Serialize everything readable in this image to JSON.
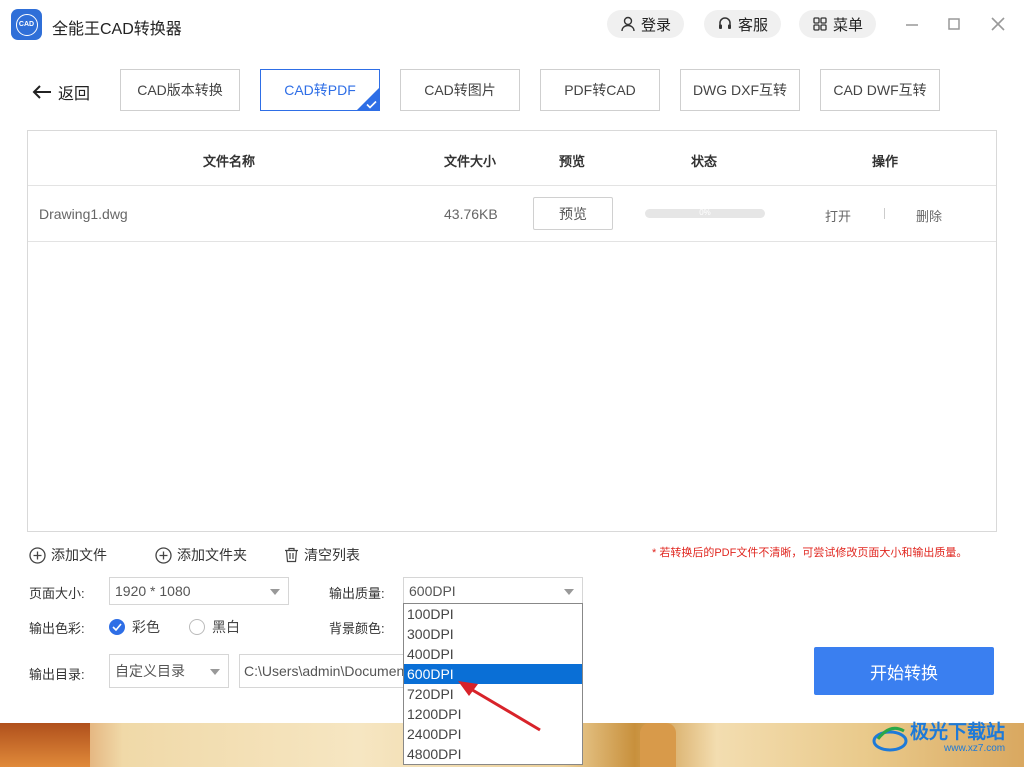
{
  "window": {
    "logo_text": "CAD",
    "title": "全能王CAD转换器",
    "login_label": "登录",
    "service_label": "客服",
    "menu_label": "菜单"
  },
  "nav": {
    "back_label": "返回",
    "tabs": [
      {
        "label": "CAD版本转换"
      },
      {
        "label": "CAD转PDF"
      },
      {
        "label": "CAD转图片"
      },
      {
        "label": "PDF转CAD"
      },
      {
        "label": "DWG DXF互转"
      },
      {
        "label": "CAD DWF互转"
      }
    ],
    "active_tab": "CAD转PDF"
  },
  "table": {
    "headers": {
      "name": "文件名称",
      "size": "文件大小",
      "preview": "预览",
      "status": "状态",
      "actions": "操作"
    },
    "rows": [
      {
        "name": "Drawing1.dwg",
        "size": "43.76KB",
        "preview_label": "预览",
        "progress_text": "0%",
        "progress": 0,
        "open_label": "打开",
        "delete_label": "删除"
      }
    ]
  },
  "actions": {
    "add_file": "添加文件",
    "add_folder": "添加文件夹",
    "clear_list": "清空列表",
    "hint": "* 若转换后的PDF文件不清晰，可尝试修改页面大小和输出质量。"
  },
  "settings": {
    "page_size_label": "页面大小:",
    "page_size_value": "1920 * 1080",
    "quality_label": "输出质量:",
    "quality_value": "600DPI",
    "color_label": "输出色彩:",
    "color_option": "彩色",
    "bw_option": "黑白",
    "selected_color": "彩色",
    "bg_color_label": "背景颜色:",
    "output_dir_label": "输出目录:",
    "output_dir_mode": "自定义目录",
    "output_path": "C:\\Users\\admin\\Documents"
  },
  "quality_dropdown": {
    "options": [
      "100DPI",
      "300DPI",
      "400DPI",
      "600DPI",
      "720DPI",
      "1200DPI",
      "2400DPI",
      "4800DPI"
    ],
    "highlighted": "600DPI"
  },
  "start_button": "开始转换",
  "watermark": {
    "text": "极光下载站",
    "sub": "www.xz7.com"
  },
  "colors": {
    "accent": "#2e6ee6",
    "start_button": "#3a7ff0",
    "dropdown_highlight": "#0a6fd6",
    "hint_red": "#e0261f"
  }
}
